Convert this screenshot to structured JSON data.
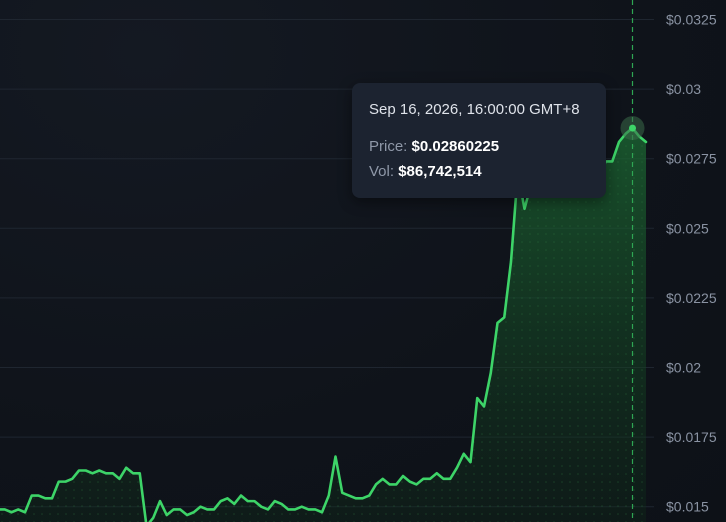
{
  "colors": {
    "background": "#0f131a",
    "grid": "#1f2630",
    "line": "#3dd468",
    "area_top": "#1c6a33",
    "crosshair": "#2ea653",
    "tooltip_bg": "#1c2330"
  },
  "tooltip": {
    "time": "Sep 16, 2026, 16:00:00 GMT+8",
    "price_label": "Price:",
    "price_value": "$0.02860225",
    "vol_label": "Vol:",
    "vol_value": "$86,742,514"
  },
  "chart_data": {
    "type": "area",
    "title": "",
    "xlabel": "",
    "ylabel": "",
    "ylim": [
      0.01445,
      0.0332
    ],
    "y_ticks": [
      {
        "value": 0.0325,
        "label": "$0.0325"
      },
      {
        "value": 0.03,
        "label": "$0.03"
      },
      {
        "value": 0.0275,
        "label": "$0.0275"
      },
      {
        "value": 0.025,
        "label": "$0.025"
      },
      {
        "value": 0.0225,
        "label": "$0.0225"
      },
      {
        "value": 0.02,
        "label": "$0.02"
      },
      {
        "value": 0.0175,
        "label": "$0.0175"
      },
      {
        "value": 0.015,
        "label": "$0.015"
      }
    ],
    "grid": true,
    "hover_index": 94,
    "series": [
      {
        "values": [
          0.0149,
          0.0149,
          0.0148,
          0.0149,
          0.0148,
          0.0154,
          0.0154,
          0.0153,
          0.0153,
          0.0159,
          0.0159,
          0.016,
          0.0163,
          0.0163,
          0.0162,
          0.0163,
          0.0162,
          0.0162,
          0.016,
          0.0164,
          0.0162,
          0.0162,
          0.0143,
          0.0146,
          0.0152,
          0.0147,
          0.0149,
          0.0149,
          0.0147,
          0.0148,
          0.015,
          0.0149,
          0.0149,
          0.0152,
          0.0153,
          0.0151,
          0.0154,
          0.0152,
          0.0152,
          0.015,
          0.0149,
          0.0152,
          0.0151,
          0.0149,
          0.0149,
          0.015,
          0.0149,
          0.0149,
          0.0148,
          0.0154,
          0.0168,
          0.0155,
          0.0154,
          0.0153,
          0.0153,
          0.0154,
          0.0158,
          0.016,
          0.0158,
          0.0158,
          0.0161,
          0.0159,
          0.0158,
          0.016,
          0.016,
          0.0162,
          0.016,
          0.016,
          0.0164,
          0.0169,
          0.0166,
          0.0189,
          0.0186,
          0.0198,
          0.0216,
          0.0218,
          0.0238,
          0.027,
          0.0257,
          0.0266,
          0.0266,
          0.0266,
          0.0266,
          0.0266,
          0.0266,
          0.0266,
          0.0266,
          0.0266,
          0.0266,
          0.0266,
          0.0274,
          0.0274,
          0.0281,
          0.0284,
          0.0286,
          0.0283,
          0.0281
        ]
      }
    ]
  }
}
